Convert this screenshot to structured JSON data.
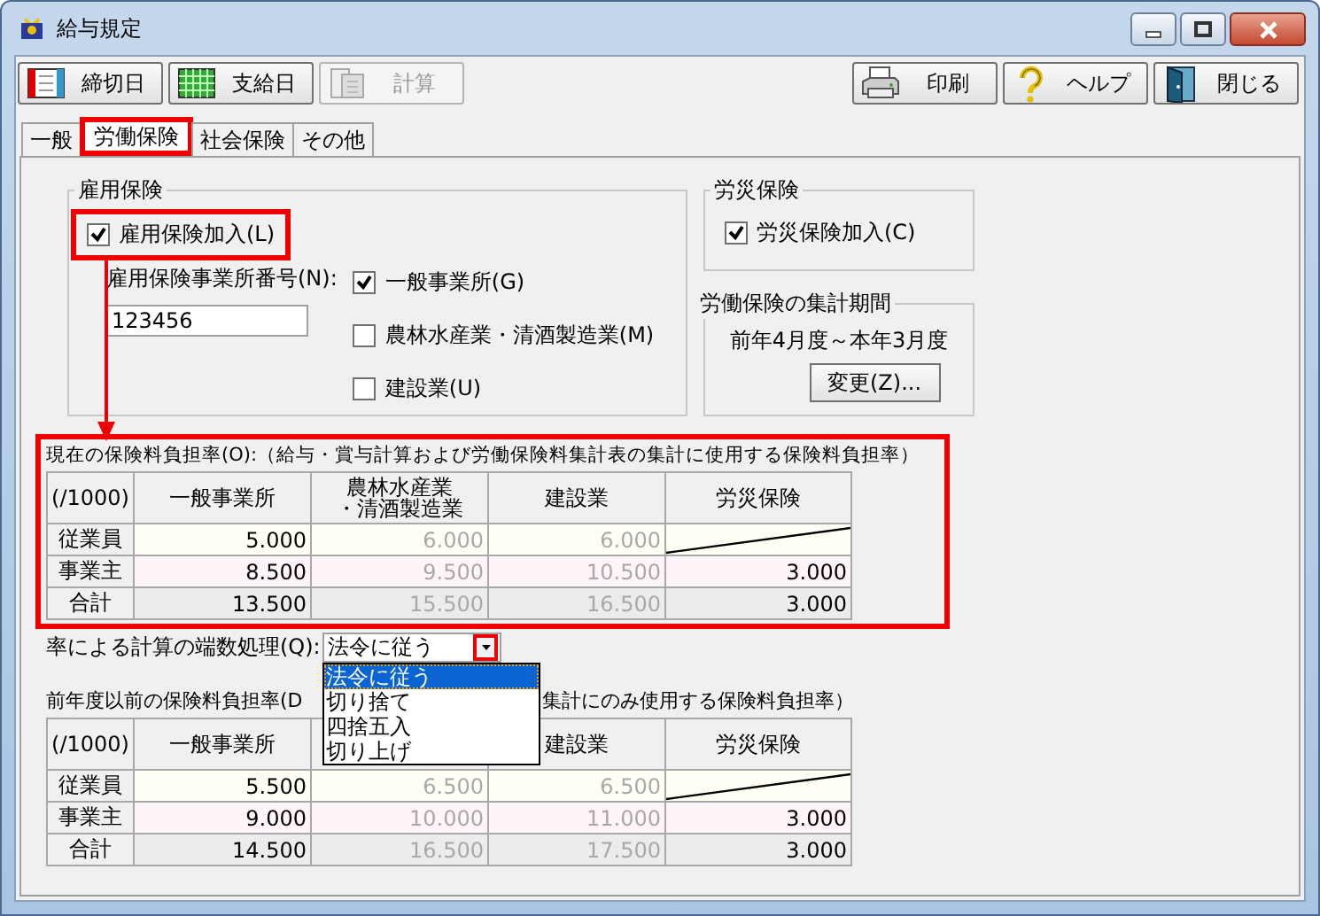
{
  "window": {
    "title": "給与規定"
  },
  "toolbar": {
    "left": [
      {
        "label": "締切日",
        "kind": "deadline",
        "disabled": false
      },
      {
        "label": "支給日",
        "kind": "payday",
        "disabled": false
      },
      {
        "label": "計算",
        "kind": "calc",
        "disabled": true
      }
    ],
    "right": [
      {
        "label": "印刷",
        "kind": "print",
        "disabled": false
      },
      {
        "label": "ヘルプ",
        "kind": "help",
        "disabled": false
      },
      {
        "label": "閉じる",
        "kind": "exit",
        "disabled": false
      }
    ]
  },
  "tabs": [
    {
      "label": "一般",
      "selected": false,
      "highlighted": false
    },
    {
      "label": "労働保険",
      "selected": true,
      "highlighted": true
    },
    {
      "label": "社会保険",
      "selected": false,
      "highlighted": false
    },
    {
      "label": "その他",
      "selected": false,
      "highlighted": false
    }
  ],
  "employment_insurance": {
    "title": "雇用保険",
    "join": {
      "label": "雇用保険加入(L)",
      "checked": true,
      "highlighted": true
    },
    "office_number": {
      "label": "雇用保険事業所番号(N):",
      "value": "123456"
    },
    "business_types": [
      {
        "label": "一般事業所(G)",
        "checked": true
      },
      {
        "label": "農林水産業・清酒製造業(M)",
        "checked": false
      },
      {
        "label": "建設業(U)",
        "checked": false
      }
    ]
  },
  "workers_comp": {
    "title": "労災保険",
    "join": {
      "label": "労災保険加入(C)",
      "checked": true
    }
  },
  "period": {
    "title": "労働保険の集計期間",
    "text": "前年4月度～本年3月度",
    "button": "変更(Z)..."
  },
  "annotation_arrow": true,
  "current_rates": {
    "label": "現在の保険料負担率(O):（給与・賞与計算および労働保険料集計表の集計に使用する保険料負担率）",
    "highlighted": true,
    "table": {
      "columns": [
        "(/1000)",
        "一般事業所",
        [
          "農林水産業",
          "・清酒製造業"
        ],
        "建設業",
        "労災保険"
      ],
      "rows": [
        {
          "kind": "employee",
          "cells": [
            {
              "kind": "header",
              "text": "従業員"
            },
            {
              "kind": "value",
              "text": "5.000",
              "disabled": false
            },
            {
              "kind": "value",
              "text": "6.000",
              "disabled": true
            },
            {
              "kind": "value",
              "text": "6.000",
              "disabled": true
            },
            {
              "kind": "diagonal"
            }
          ]
        },
        {
          "kind": "employer",
          "cells": [
            {
              "kind": "header",
              "text": "事業主"
            },
            {
              "kind": "value",
              "text": "8.500",
              "disabled": false
            },
            {
              "kind": "value",
              "text": "9.500",
              "disabled": true
            },
            {
              "kind": "value",
              "text": "10.500",
              "disabled": true
            },
            {
              "kind": "value",
              "text": "3.000",
              "disabled": false
            }
          ]
        },
        {
          "kind": "total",
          "cells": [
            {
              "kind": "header",
              "text": "合計"
            },
            {
              "kind": "value",
              "text": "13.500",
              "disabled": false
            },
            {
              "kind": "value",
              "text": "15.500",
              "disabled": true
            },
            {
              "kind": "value",
              "text": "16.500",
              "disabled": true
            },
            {
              "kind": "value",
              "text": "3.000",
              "disabled": false
            }
          ]
        }
      ]
    }
  },
  "rounding": {
    "label": "率による計算の端数処理(Q):",
    "value": "法令に従う",
    "highlighted": true,
    "open": true,
    "options": [
      {
        "label": "法令に従う",
        "selected": true
      },
      {
        "label": "切り捨て",
        "selected": false
      },
      {
        "label": "四捨五入",
        "selected": false
      },
      {
        "label": "切り上げ",
        "selected": false
      }
    ]
  },
  "previous_rates": {
    "label_parts": [
      "前年度以前の保険料負担率(D",
      "集計にのみ使用する保険料負担率）"
    ],
    "table": {
      "columns": [
        "(/1000)",
        "一般事業所",
        null,
        "建設業",
        "労災保険"
      ],
      "rows": [
        {
          "kind": "employee",
          "cells": [
            {
              "kind": "header",
              "text": "従業員"
            },
            {
              "kind": "value",
              "text": "5.500",
              "disabled": false
            },
            {
              "kind": "value",
              "text": "6.500",
              "disabled": true
            },
            {
              "kind": "value",
              "text": "6.500",
              "disabled": true
            },
            {
              "kind": "diagonal"
            }
          ]
        },
        {
          "kind": "employer",
          "cells": [
            {
              "kind": "header",
              "text": "事業主"
            },
            {
              "kind": "value",
              "text": "9.000",
              "disabled": false
            },
            {
              "kind": "value",
              "text": "10.000",
              "disabled": true
            },
            {
              "kind": "value",
              "text": "11.000",
              "disabled": true
            },
            {
              "kind": "value",
              "text": "3.000",
              "disabled": false
            }
          ]
        },
        {
          "kind": "total",
          "cells": [
            {
              "kind": "header",
              "text": "合計"
            },
            {
              "kind": "value",
              "text": "14.500",
              "disabled": false
            },
            {
              "kind": "value",
              "text": "16.500",
              "disabled": true
            },
            {
              "kind": "value",
              "text": "17.500",
              "disabled": true
            },
            {
              "kind": "value",
              "text": "3.000",
              "disabled": false
            }
          ]
        }
      ]
    }
  }
}
